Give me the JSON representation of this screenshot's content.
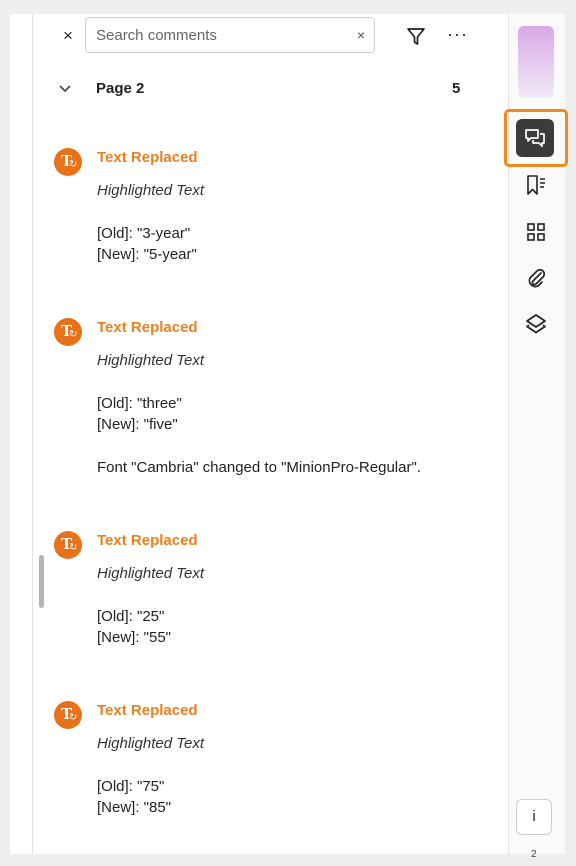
{
  "search": {
    "placeholder": "Search comments",
    "close_symbol": "×",
    "clear_symbol": "×",
    "more_symbol": "···"
  },
  "page_group": {
    "label": "Page 2",
    "count": "5"
  },
  "comments": [
    {
      "title": "Text Replaced",
      "subtitle": "Highlighted Text",
      "lines": [
        "[Old]: \"3-year\"",
        "[New]: \"5-year\""
      ]
    },
    {
      "title": "Text Replaced",
      "subtitle": "Highlighted Text",
      "lines": [
        "[Old]: \"three\"",
        "[New]: \"five\"",
        "Font \"Cambria\" changed to \"MinionPro-Regular\"."
      ]
    },
    {
      "title": "Text Replaced",
      "subtitle": "Highlighted Text",
      "lines": [
        "[Old]: \"25\"",
        "[New]: \"55\""
      ]
    },
    {
      "title": "Text Replaced",
      "subtitle": "Highlighted Text",
      "lines": [
        "[Old]: \"75\"",
        "[New]: \"85\""
      ]
    }
  ],
  "avatar_glyph": "T",
  "avatar_badge": "↻",
  "rail": {
    "icons": [
      "comments-icon",
      "bookmarks-icon",
      "thumbnails-icon",
      "attachments-icon",
      "layers-icon"
    ],
    "info_label": "i",
    "fragment_text": "2"
  },
  "colors": {
    "accent": "#e8801f",
    "avatar": "#e8711a",
    "highlight": "#f08a1c",
    "active_tab": "#3b3b3b"
  }
}
